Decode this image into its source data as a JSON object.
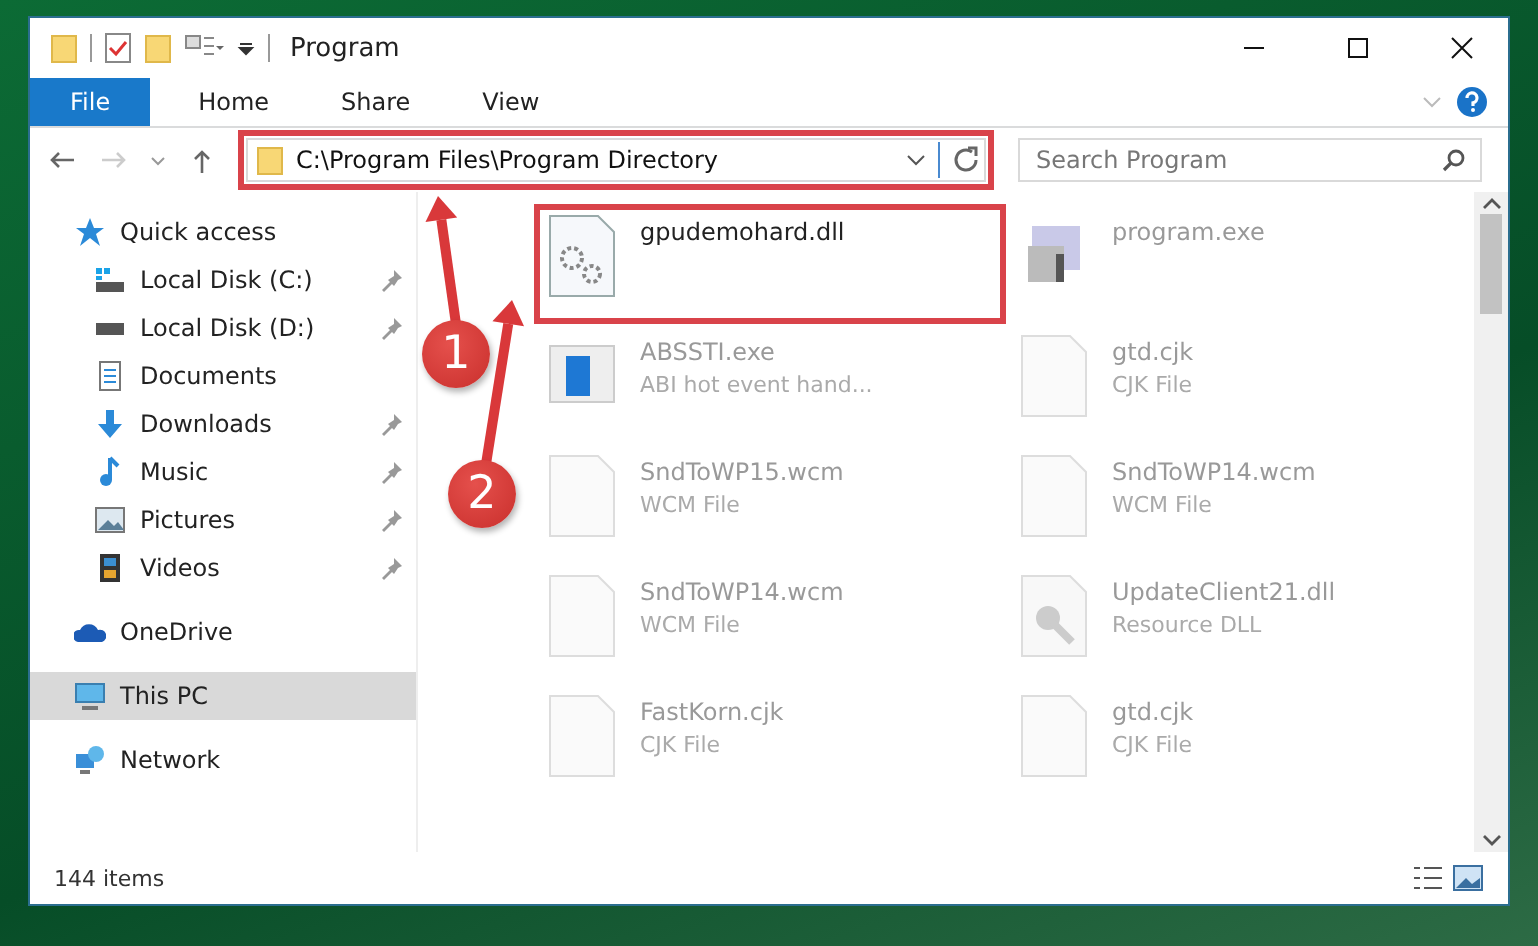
{
  "window": {
    "title": "Program"
  },
  "ribbon_tabs": [
    {
      "label": "File",
      "selected": true
    },
    {
      "label": "Home",
      "selected": false
    },
    {
      "label": "Share",
      "selected": false
    },
    {
      "label": "View",
      "selected": false
    }
  ],
  "address": {
    "path": "C:\\Program Files\\Program Directory",
    "highlighted": true
  },
  "search": {
    "placeholder": "Search Program"
  },
  "sidebar": {
    "items": [
      {
        "label": "Quick access",
        "kind": "star",
        "selected": false,
        "children": [
          {
            "label": "Local Disk (C:)",
            "kind": "windrive",
            "pinned": true,
            "selected": false
          },
          {
            "label": "Local Disk (D:)",
            "kind": "drive",
            "pinned": true,
            "selected": false
          },
          {
            "label": "Documents",
            "kind": "document",
            "pinned": false,
            "selected": false
          },
          {
            "label": "Downloads",
            "kind": "download",
            "pinned": true,
            "selected": false
          },
          {
            "label": "Music",
            "kind": "music",
            "pinned": true,
            "selected": false
          },
          {
            "label": "Pictures",
            "kind": "pictures",
            "pinned": true,
            "selected": false
          },
          {
            "label": "Videos",
            "kind": "videos",
            "pinned": true,
            "selected": false
          }
        ]
      },
      {
        "label": "OneDrive",
        "kind": "cloud",
        "selected": false
      },
      {
        "label": "This PC",
        "kind": "computer",
        "selected": true
      },
      {
        "label": "Network",
        "kind": "network",
        "selected": false
      }
    ]
  },
  "files": [
    {
      "name": "gpudemohard.dll",
      "kind": "dll",
      "highlighted": true
    },
    {
      "name": "program.exe",
      "kind": "exe",
      "highlighted": false
    },
    {
      "name": "ABSSTI.exe",
      "type": "ABI hot event hand...",
      "kind": "app",
      "highlighted": false
    },
    {
      "name": "gtd.cjk",
      "type": "CJK File",
      "kind": "blank",
      "highlighted": false
    },
    {
      "name": "SndToWP15.wcm",
      "type": "WCM File",
      "kind": "blank",
      "highlighted": false
    },
    {
      "name": "SndToWP14.wcm",
      "type": "WCM File",
      "kind": "blank",
      "highlighted": false
    },
    {
      "name": "SndToWP14.wcm",
      "type": "WCM File",
      "kind": "blank",
      "highlighted": false
    },
    {
      "name": "UpdateClient21.dll",
      "type": "Resource DLL",
      "kind": "resource",
      "highlighted": false
    },
    {
      "name": "FastKorn.cjk",
      "type": "CJK File",
      "kind": "blank",
      "highlighted": false
    },
    {
      "name": "gtd.cjk",
      "type": "CJK File",
      "kind": "blank",
      "highlighted": false
    }
  ],
  "status_bar": {
    "count": "144 items"
  },
  "annotations": [
    {
      "number": "1"
    },
    {
      "number": "2"
    }
  ]
}
